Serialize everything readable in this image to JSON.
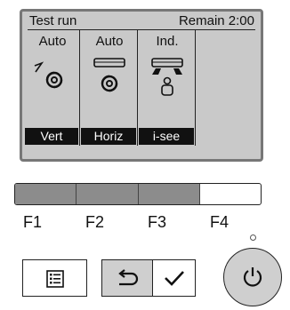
{
  "screen": {
    "status_left": "Test run",
    "status_right": "Remain 2:00",
    "columns": [
      {
        "title": "Auto",
        "icon": "vane-vertical-swing-icon"
      },
      {
        "title": "Auto",
        "icon": "vane-horizontal-swing-icon"
      },
      {
        "title": "Ind.",
        "icon": "i-see-sensor-person-icon"
      }
    ],
    "soft_labels": [
      "Vert",
      "Horiz",
      "i-see"
    ]
  },
  "function_keys": {
    "labels": [
      "F1",
      "F2",
      "F3",
      "F4"
    ],
    "colors": {
      "active": "#8c8c8c",
      "inactive": "#ffffff"
    }
  },
  "buttons": {
    "menu": "menu-icon",
    "back": "return-arrow-icon",
    "confirm": "checkmark-icon",
    "power": "power-icon",
    "colors": {
      "back_bg": "#cfcfcf",
      "power_bg": "#cfcfcf"
    }
  }
}
